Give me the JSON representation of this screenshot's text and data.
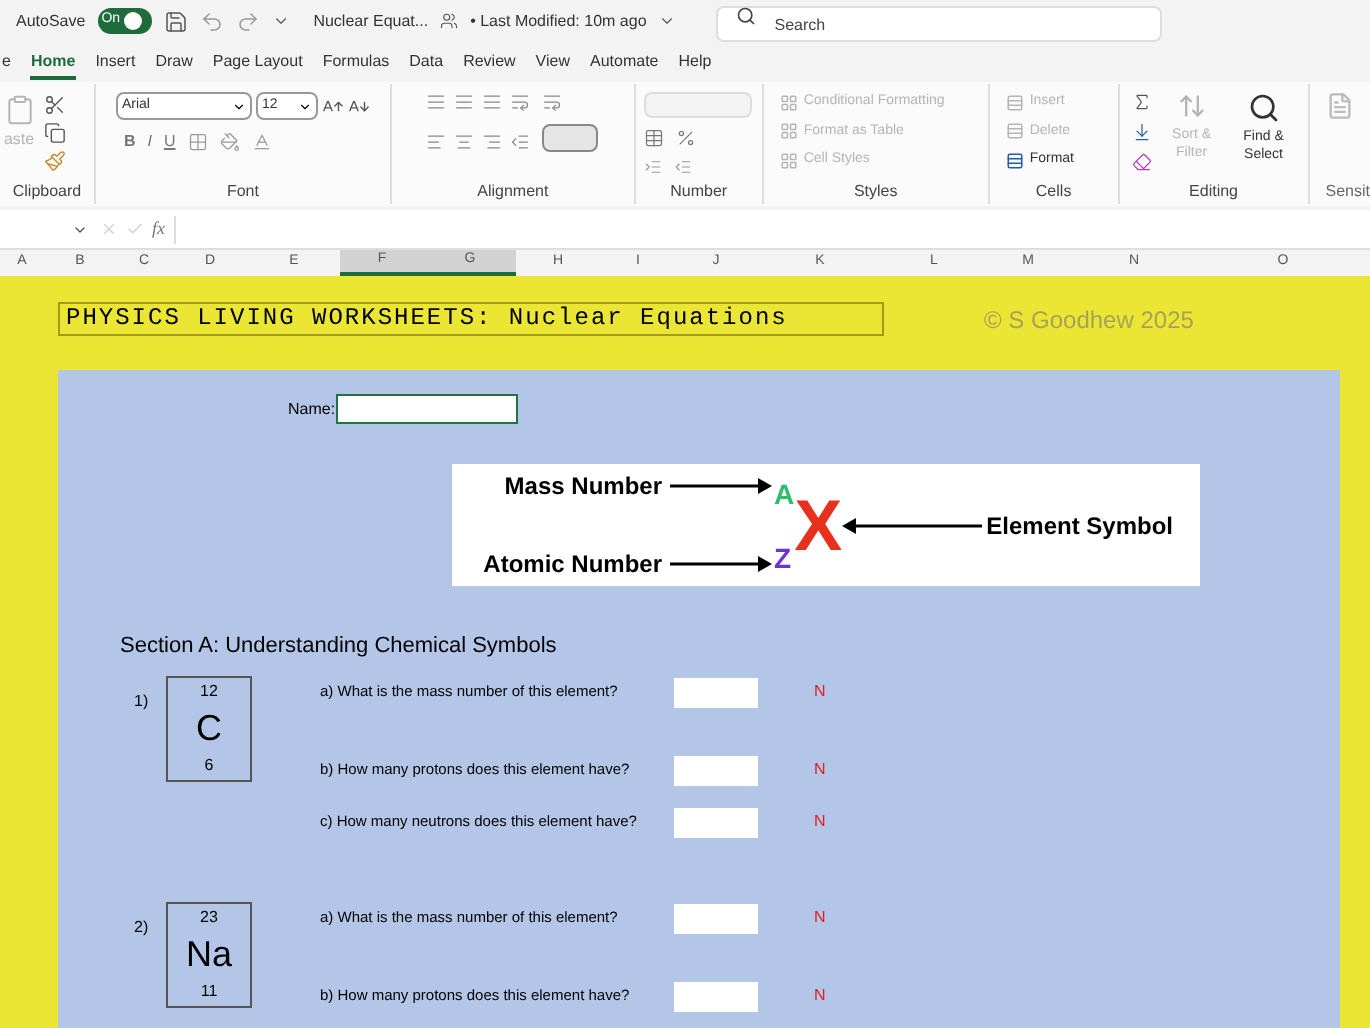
{
  "title_bar": {
    "autosave_label": "AutoSave",
    "autosave_toggle": {
      "label": "On",
      "on": true
    },
    "document_title": "Nuclear Equat...",
    "modified": "• Last Modified: 10m ago",
    "search": {
      "placeholder": "Search"
    }
  },
  "ribbon_tabs": [
    {
      "label": "e",
      "selected": false
    },
    {
      "label": "Home",
      "selected": true
    },
    {
      "label": "Insert",
      "selected": false
    },
    {
      "label": "Draw",
      "selected": false
    },
    {
      "label": "Page Layout",
      "selected": false
    },
    {
      "label": "Formulas",
      "selected": false
    },
    {
      "label": "Data",
      "selected": false
    },
    {
      "label": "Review",
      "selected": false
    },
    {
      "label": "View",
      "selected": false
    },
    {
      "label": "Automate",
      "selected": false
    },
    {
      "label": "Help",
      "selected": false
    }
  ],
  "ribbon": {
    "clipboard": {
      "group_label": "Clipboard",
      "paste": {
        "label": "aste",
        "disabled": true
      }
    },
    "font": {
      "group_label": "Font",
      "font_name": "Arial",
      "font_size": "12",
      "bold": "B",
      "italic": "I",
      "underline": "U"
    },
    "alignment": {
      "group_label": "Alignment"
    },
    "number": {
      "group_label": "Number"
    },
    "styles": {
      "group_label": "Styles",
      "buttons": [
        {
          "label": "Conditional Formatting",
          "disabled": true
        },
        {
          "label": "Format as Table",
          "disabled": true
        },
        {
          "label": "Cell Styles",
          "disabled": true
        }
      ]
    },
    "cells": {
      "group_label": "Cells",
      "buttons": [
        {
          "label": "Insert",
          "disabled": true
        },
        {
          "label": "Delete",
          "disabled": true
        },
        {
          "label": "Format",
          "disabled": false
        }
      ]
    },
    "editing": {
      "group_label": "Editing",
      "buttons": [
        {
          "label": "Sort & Filter",
          "disabled": true
        },
        {
          "label": "Find & Select",
          "disabled": false
        }
      ]
    },
    "sensitivity": {
      "group_label": "Sensit",
      "disabled": true
    }
  },
  "formula_bar": {
    "function_label": "fx"
  },
  "columns": [
    {
      "label": "A",
      "selected": false
    },
    {
      "label": "B",
      "selected": false
    },
    {
      "label": "C",
      "selected": false
    },
    {
      "label": "D",
      "selected": false
    },
    {
      "label": "E",
      "selected": false
    },
    {
      "label": "F",
      "selected": true
    },
    {
      "label": "G",
      "selected": true
    },
    {
      "label": "H",
      "selected": false
    },
    {
      "label": "I",
      "selected": false
    },
    {
      "label": "J",
      "selected": false
    },
    {
      "label": "K",
      "selected": false
    },
    {
      "label": "L",
      "selected": false
    },
    {
      "label": "M",
      "selected": false
    },
    {
      "label": "N",
      "selected": false
    },
    {
      "label": "O",
      "selected": false
    }
  ],
  "worksheet": {
    "title": "PHYSICS LIVING WORKSHEETS: Nuclear Equations",
    "copyright": "© S Goodhew 2025",
    "name_label": "Name:",
    "diagram": {
      "mass_label": "Mass Number",
      "atomic_label": "Atomic Number",
      "element_label": "Element Symbol",
      "mass_letter": "A",
      "symbol_letter": "X",
      "atomic_letter": "Z"
    },
    "section_heading": "Section A: Understanding Chemical Symbols",
    "questions": [
      {
        "number": "1)",
        "mass": "12",
        "symbol": "C",
        "atomic": "6",
        "parts": [
          {
            "text": "a) What is the mass number of this element?",
            "mark": "N"
          },
          {
            "text": "b) How many protons does this element have?",
            "mark": "N"
          },
          {
            "text": "c) How many neutrons does this element have?",
            "mark": "N"
          }
        ]
      },
      {
        "number": "2)",
        "mass": "23",
        "symbol": "Na",
        "atomic": "11",
        "parts": [
          {
            "text": "a) What is the mass number of this element?",
            "mark": "N"
          },
          {
            "text": "b) How many protons does this element have?",
            "mark": "N"
          }
        ]
      }
    ]
  }
}
